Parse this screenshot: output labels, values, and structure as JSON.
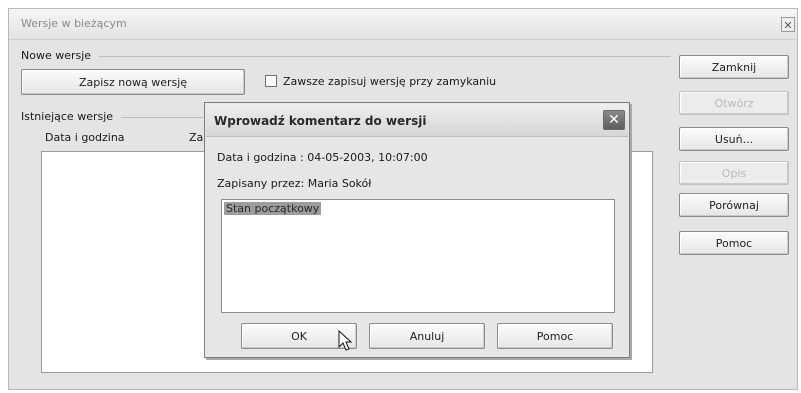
{
  "window": {
    "title": "Wersje w bieżącym",
    "close_glyph": "✕"
  },
  "new_versions": {
    "group_label": "Nowe wersje",
    "save_button": "Zapisz nową wersję",
    "autosave_checkbox_label": "Zawsze zapisuj wersję przy zamykaniu",
    "autosave_checked": false
  },
  "existing_versions": {
    "group_label": "Istniejące wersje",
    "columns": [
      "Data i godzina",
      "Za"
    ],
    "rows": []
  },
  "side_buttons": [
    {
      "label": "Zamknij",
      "enabled": true
    },
    {
      "label": "Otwórz",
      "enabled": false
    },
    {
      "label": "Usuń...",
      "enabled": true
    },
    {
      "label": "Opis",
      "enabled": false
    },
    {
      "label": "Porównaj",
      "enabled": true
    },
    {
      "label": "Pomoc",
      "enabled": true
    }
  ],
  "dialog": {
    "title": "Wprowadź komentarz do wersji",
    "close_glyph": "✕",
    "datetime_line": "Data i godzina : 04-05-2003, 10:07:00",
    "saved_by_line": "Zapisany przez: Maria Sokół",
    "comment_value": "Stan początkowy",
    "ok_label": "OK",
    "cancel_label": "Anuluj",
    "help_label": "Pomoc"
  }
}
